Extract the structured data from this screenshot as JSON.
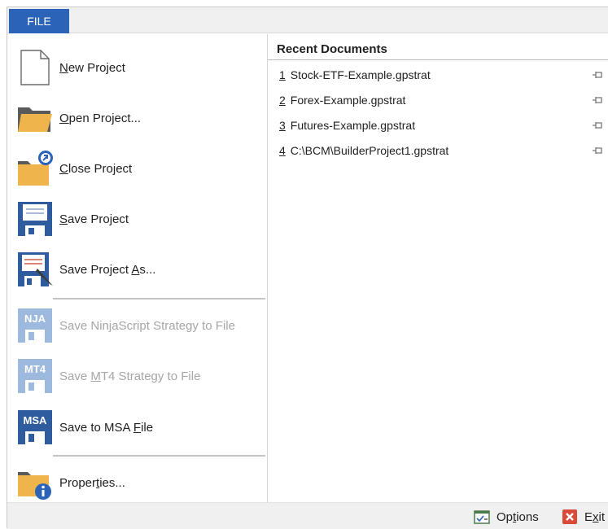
{
  "tab": {
    "file": "FILE"
  },
  "menu": [
    {
      "pre": "",
      "u": "N",
      "post": "ew Project",
      "icon": "new-document-icon",
      "enabled": true
    },
    {
      "pre": "",
      "u": "O",
      "post": "pen Project...",
      "icon": "open-folder-icon",
      "enabled": true
    },
    {
      "pre": "",
      "u": "C",
      "post": "lose Project",
      "icon": "close-folder-icon",
      "enabled": true
    },
    {
      "pre": "",
      "u": "S",
      "post": "ave Project",
      "icon": "save-disk-icon",
      "enabled": true
    },
    {
      "pre": "Save Project ",
      "u": "A",
      "post": "s...",
      "icon": "save-as-icon",
      "enabled": true
    },
    {
      "pre": "Save Nin",
      "u": "j",
      "post": "aScript Strategy to File",
      "icon": "nja-disk-icon",
      "icon_text": "NJA",
      "enabled": false
    },
    {
      "pre": "Save ",
      "u": "M",
      "post": "T4 Strategy to File",
      "icon": "mt4-disk-icon",
      "icon_text": "MT4",
      "enabled": false
    },
    {
      "pre": "Save to MSA ",
      "u": "F",
      "post": "ile",
      "icon": "msa-disk-icon",
      "icon_text": "MSA",
      "enabled": true
    },
    {
      "pre": "Proper",
      "u": "t",
      "post": "ies...",
      "icon": "properties-folder-icon",
      "enabled": true
    }
  ],
  "recent": {
    "heading": "Recent Documents",
    "items": [
      {
        "num": "1",
        "name": "Stock-ETF-Example.gpstrat"
      },
      {
        "num": "2",
        "name": "Forex-Example.gpstrat"
      },
      {
        "num": "3",
        "name": "Futures-Example.gpstrat"
      },
      {
        "num": "4",
        "name": "C:\\BCM\\BuilderProject1.gpstrat"
      }
    ]
  },
  "footer": {
    "options": {
      "pre": "Op",
      "u": "t",
      "post": "ions"
    },
    "exit": {
      "pre": "E",
      "u": "x",
      "post": "it"
    }
  },
  "colors": {
    "accent": "#2b63b8",
    "folder": "#f0b44c",
    "disk": "#2e5c9e",
    "disabled": "#a6a6a6",
    "exit": "#d94a3a"
  }
}
